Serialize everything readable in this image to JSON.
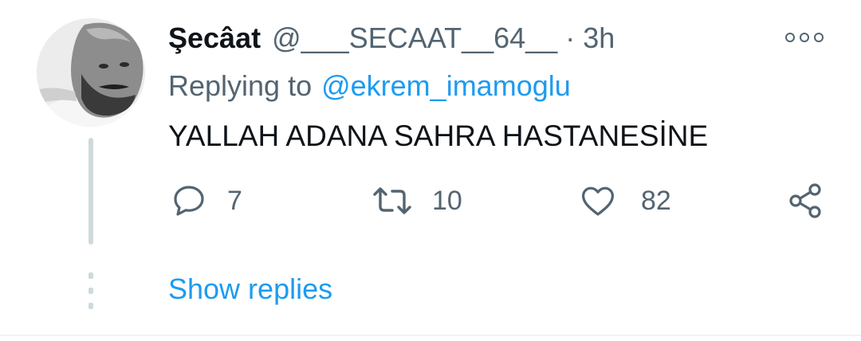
{
  "tweet": {
    "author_name": "Şecâat",
    "handle": "@___SECAAT__64__",
    "separator": "·",
    "time": "3h",
    "replying_to_label": "Replying to",
    "replying_to_handle": "@ekrem_imamoglu",
    "text": "YALLAH ADANA SAHRA HASTANESİNE"
  },
  "actions": {
    "reply_count": "7",
    "retweet_count": "10",
    "like_count": "82"
  },
  "thread": {
    "show_replies_label": "Show replies"
  },
  "icons": {
    "more": "more-options-icon",
    "reply": "reply-icon",
    "retweet": "retweet-icon",
    "like": "heart-icon",
    "share": "share-icon"
  },
  "colors": {
    "link": "#1d9bf0",
    "secondary_text": "#536471",
    "primary_text": "#0f1419",
    "thread_line": "#cfd9de"
  }
}
